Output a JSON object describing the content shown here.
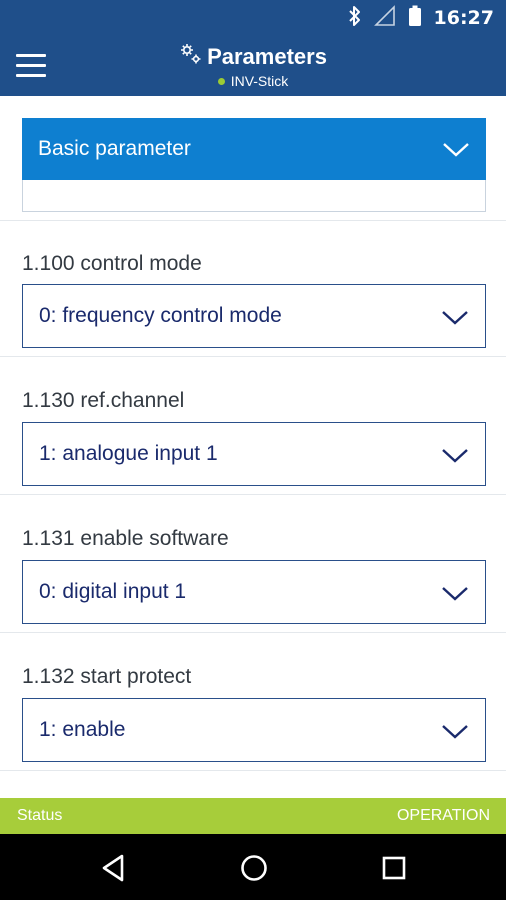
{
  "status_bar": {
    "time": "16:27",
    "icons": [
      "bluetooth-icon",
      "signal-icon",
      "battery-icon"
    ]
  },
  "app_bar": {
    "title": "Parameters",
    "subtitle": "INV-Stick",
    "menu_icon": "hamburger-icon",
    "title_icon": "gears-icon",
    "connection_dot_color": "#9ccb34"
  },
  "group_selector": {
    "selected": "Basic parameter"
  },
  "parameters": [
    {
      "label": "1.100 control mode",
      "value": "0: frequency control mode"
    },
    {
      "label": "1.130 ref.channel",
      "value": "1: analogue input 1"
    },
    {
      "label": "1.131 enable software",
      "value": "0: digital input 1"
    },
    {
      "label": "1.132 start protect",
      "value": "1: enable"
    }
  ],
  "status_line": {
    "left": "Status",
    "right": "OPERATION"
  },
  "nav_bar": {
    "icons": [
      "back-icon",
      "home-icon",
      "recents-icon"
    ]
  },
  "colors": {
    "primary": "#1f4f8a",
    "accent_blue": "#0e7fd0",
    "status_green": "#a7cd3a"
  }
}
